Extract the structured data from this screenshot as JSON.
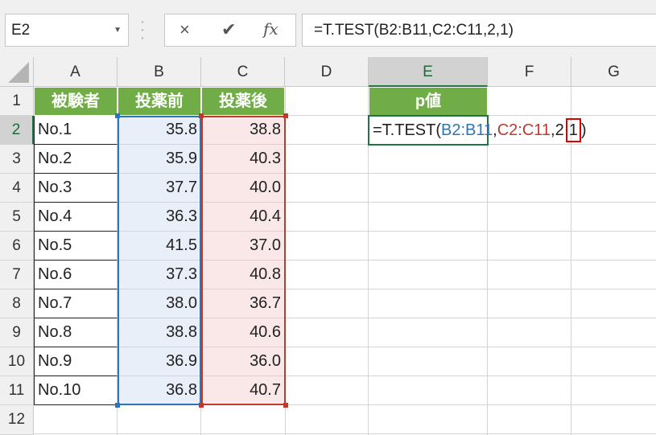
{
  "name_box": "E2",
  "formula_bar": {
    "text": "=T.TEST(B2:B11,C2:C11,2,1)",
    "cancel_icon": "×",
    "enter_icon": "✔",
    "fx_label": "fx"
  },
  "columns": [
    "A",
    "B",
    "C",
    "D",
    "E",
    "F",
    "G"
  ],
  "rows": [
    "1",
    "2",
    "3",
    "4",
    "5",
    "6",
    "7",
    "8",
    "9",
    "10",
    "11",
    "12"
  ],
  "headers": {
    "A": "被験者",
    "B": "投薬前",
    "C": "投薬後",
    "E": "p値"
  },
  "table": [
    {
      "subject": "No.1",
      "before": "35.8",
      "after": "38.8"
    },
    {
      "subject": "No.2",
      "before": "35.9",
      "after": "40.3"
    },
    {
      "subject": "No.3",
      "before": "37.7",
      "after": "40.0"
    },
    {
      "subject": "No.4",
      "before": "36.3",
      "after": "40.4"
    },
    {
      "subject": "No.5",
      "before": "41.5",
      "after": "37.0"
    },
    {
      "subject": "No.6",
      "before": "37.3",
      "after": "40.8"
    },
    {
      "subject": "No.7",
      "before": "38.0",
      "after": "36.7"
    },
    {
      "subject": "No.8",
      "before": "38.8",
      "after": "40.6"
    },
    {
      "subject": "No.9",
      "before": "36.9",
      "after": "36.0"
    },
    {
      "subject": "No.10",
      "before": "36.8",
      "after": "40.7"
    }
  ],
  "editing_cell": {
    "prefix": "=T.TEST(",
    "range1": "B2:B11",
    "sep1": ",",
    "range2": "C2:C11",
    "mid": ",2",
    "highlighted": "1",
    "suffix": ")"
  },
  "colors": {
    "header_green": "#70ad47",
    "range1_blue": "#2e75b6",
    "range2_red": "#c0392b",
    "highlight_box": "#e00000"
  }
}
